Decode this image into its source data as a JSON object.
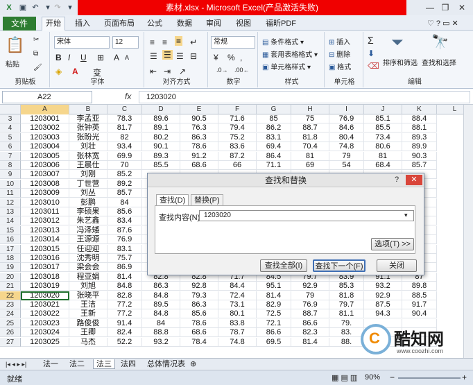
{
  "window": {
    "title": "素材.xlsx - Microsoft Excel(产品激活失败)",
    "minimize": "—",
    "maximize": "❐",
    "close": "✕"
  },
  "tabs": [
    "文件",
    "开始",
    "插入",
    "页面布局",
    "公式",
    "数据",
    "审阅",
    "视图",
    "福昕PDF"
  ],
  "ribbon": {
    "clipboard": {
      "label": "剪贴板",
      "paste": "粘贴"
    },
    "font": {
      "label": "字体",
      "name": "宋体",
      "size": "12",
      "bold": "B",
      "italic": "I",
      "underline": "U",
      "grow": "A",
      "shrink": "A"
    },
    "align": {
      "label": "对齐方式"
    },
    "number": {
      "label": "数字",
      "format": "常规",
      "percent": "%",
      "comma": ","
    },
    "styles": {
      "label": "样式",
      "conditional": "条件格式",
      "table": "套用表格格式",
      "cell": "单元格样式"
    },
    "cells": {
      "label": "单元格",
      "insert": "插入",
      "delete": "删除",
      "format": "格式"
    },
    "edit": {
      "label": "编辑",
      "sum": "Σ",
      "sort": "排序和筛选",
      "find": "查找和选择"
    }
  },
  "formula": {
    "namebox": "A22",
    "fx": "fx",
    "value": "1203020"
  },
  "columns": [
    "A",
    "B",
    "C",
    "D",
    "E",
    "F",
    "G",
    "H",
    "I",
    "J",
    "K",
    "L"
  ],
  "rows": [
    {
      "n": "3",
      "cells": [
        "1203001",
        "李孟亚",
        "78.3",
        "89.6",
        "90.5",
        "71.6",
        "85",
        "75",
        "76.9",
        "85.1",
        "88.4"
      ]
    },
    {
      "n": "4",
      "cells": [
        "1203002",
        "张钟英",
        "81.7",
        "89.1",
        "76.3",
        "79.4",
        "86.2",
        "88.7",
        "84.6",
        "85.5",
        "88.1"
      ]
    },
    {
      "n": "5",
      "cells": [
        "1203003",
        "张盼光",
        "82",
        "80.2",
        "86.3",
        "75.2",
        "83.1",
        "81.8",
        "80.4",
        "73.4",
        "89.3"
      ]
    },
    {
      "n": "6",
      "cells": [
        "1203004",
        "刘壮",
        "93.4",
        "90.1",
        "78.6",
        "83.6",
        "69.4",
        "70.4",
        "74.8",
        "80.6",
        "89.9"
      ]
    },
    {
      "n": "7",
      "cells": [
        "1203005",
        "张林宽",
        "69.9",
        "89.3",
        "91.2",
        "87.2",
        "86.4",
        "81",
        "79",
        "81",
        "90.3"
      ]
    },
    {
      "n": "8",
      "cells": [
        "1203006",
        "王晨仕",
        "70",
        "85.5",
        "68.6",
        "66",
        "71.1",
        "69",
        "54",
        "68.4",
        "85.7"
      ]
    },
    {
      "n": "9",
      "cells": [
        "1203007",
        "刘刚",
        "85.2",
        "",
        "",
        "",
        "",
        "",
        "",
        "",
        ""
      ]
    },
    {
      "n": "10",
      "cells": [
        "1203008",
        "丁世营",
        "89.2",
        "",
        "",
        "",
        "",
        "",
        "",
        "",
        ""
      ]
    },
    {
      "n": "11",
      "cells": [
        "1203009",
        "刘丛",
        "85.7",
        "",
        "",
        "",
        "",
        "",
        "",
        "",
        ""
      ]
    },
    {
      "n": "12",
      "cells": [
        "1203010",
        "彭鹏",
        "84",
        "",
        "",
        "",
        "",
        "",
        "",
        "",
        ""
      ]
    },
    {
      "n": "13",
      "cells": [
        "1203011",
        "李硕果",
        "85.6",
        "",
        "",
        "",
        "",
        "",
        "",
        "",
        ""
      ]
    },
    {
      "n": "14",
      "cells": [
        "1203012",
        "朱艺鑫",
        "83.4",
        "",
        "",
        "",
        "",
        "",
        "",
        "",
        ""
      ]
    },
    {
      "n": "15",
      "cells": [
        "1203013",
        "冯泽矮",
        "87.6",
        "",
        "",
        "",
        "",
        "",
        "",
        "",
        ""
      ]
    },
    {
      "n": "16",
      "cells": [
        "1203014",
        "王源源",
        "76.9",
        "",
        "",
        "",
        "",
        "",
        "",
        "",
        ""
      ]
    },
    {
      "n": "17",
      "cells": [
        "1203015",
        "任迎迎",
        "83.1",
        "",
        "",
        "",
        "",
        "",
        "",
        "",
        ""
      ]
    },
    {
      "n": "18",
      "cells": [
        "1203016",
        "沈秀明",
        "75.7",
        "",
        "",
        "",
        "",
        "",
        "",
        "",
        ""
      ]
    },
    {
      "n": "19",
      "cells": [
        "1203017",
        "梁会会",
        "86.9",
        "",
        "",
        "",
        "",
        "",
        "",
        "",
        ""
      ]
    },
    {
      "n": "20",
      "cells": [
        "1203018",
        "程亚娟",
        "81.4",
        "82.8",
        "82.8",
        "71.7",
        "84.5",
        "79.7",
        "83.9",
        "91.1",
        "87"
      ]
    },
    {
      "n": "21",
      "cells": [
        "1203019",
        "刘旭",
        "84.8",
        "86.3",
        "92.8",
        "84.4",
        "95.1",
        "92.9",
        "85.3",
        "93.2",
        "89.8"
      ]
    },
    {
      "n": "22",
      "cells": [
        "1203020",
        "张晓平",
        "82.8",
        "84.8",
        "79.3",
        "72.4",
        "81.4",
        "79",
        "81.8",
        "92.9",
        "88.5"
      ]
    },
    {
      "n": "23",
      "cells": [
        "1203021",
        "王洁",
        "77.2",
        "89.5",
        "86.3",
        "73.1",
        "82.9",
        "76.9",
        "79.7",
        "87.5",
        "91.7"
      ]
    },
    {
      "n": "24",
      "cells": [
        "1203022",
        "王新",
        "77.2",
        "84.8",
        "85.6",
        "80.1",
        "72.5",
        "88.7",
        "81.1",
        "94.3",
        "90.4"
      ]
    },
    {
      "n": "25",
      "cells": [
        "1203023",
        "路俊俊",
        "91.4",
        "84",
        "78.6",
        "83.8",
        "72.1",
        "86.6",
        "79.",
        "",
        ""
      ]
    },
    {
      "n": "26",
      "cells": [
        "1203024",
        "王卿",
        "82.4",
        "88.8",
        "68.6",
        "78.7",
        "86.6",
        "82.3",
        "83.",
        "",
        ""
      ]
    },
    {
      "n": "27",
      "cells": [
        "1203025",
        "马杰",
        "52.2",
        "93.2",
        "78.4",
        "74.8",
        "69.5",
        "81.4",
        "88.",
        "",
        ""
      ]
    }
  ],
  "sheets": [
    "法一",
    "法二",
    "法三",
    "法四",
    "总体情况表"
  ],
  "status": {
    "ready": "就绪",
    "zoom": "90%",
    "minus": "−",
    "plus": "+"
  },
  "dialog": {
    "title": "查找和替换",
    "help": "?",
    "close": "✕",
    "tab_find": "查找(D)",
    "tab_replace": "替换(P)",
    "find_label": "查找内容(N):",
    "find_value": "1203020",
    "options": "选项(T) >>",
    "find_all": "查找全部(I)",
    "find_next": "查找下一个(F)",
    "close_btn": "关闭"
  },
  "watermark": {
    "brand": "酷知网",
    "url": "www.coozhi.com"
  },
  "colors": {
    "accent": "#2e7d32",
    "title_red": "#f00000",
    "selected_cell": "#1f6f2e",
    "header_sel": "#f6d68c",
    "dialog_close": "#d9453a"
  }
}
